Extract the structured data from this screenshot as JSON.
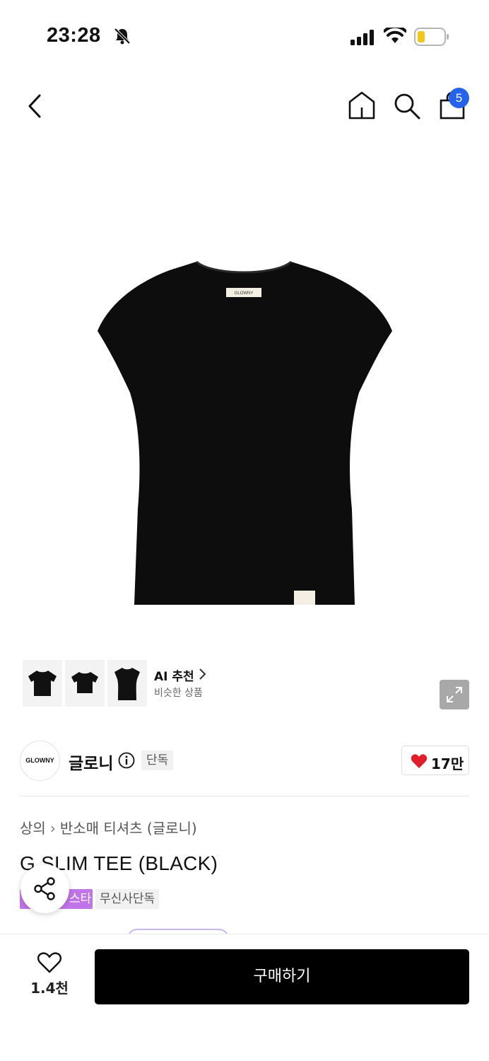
{
  "status_bar": {
    "time": "23:28",
    "icons": [
      "bell-mute-icon",
      "signal-icon",
      "wifi-icon",
      "battery-icon"
    ]
  },
  "nav": {
    "cart_count": "5",
    "icons": [
      "back-icon",
      "home-icon",
      "search-icon",
      "shopping-bag-icon"
    ]
  },
  "product_image": {
    "label_text": "GLOWNY"
  },
  "ai_recommend": {
    "title": "AI 추천",
    "subtitle": "비슷한 상품"
  },
  "brand": {
    "logo_text": "GLOWNY",
    "name": "글로니",
    "exclusive_tag": "단독",
    "likes": "17만"
  },
  "breadcrumb": {
    "category": "상의",
    "subcategory": "반소매 티셔츠 (글로니)"
  },
  "product": {
    "title": "G SLIM TEE (BLACK)",
    "tag_star": "스타",
    "tag_exclusive": "무신사단독"
  },
  "bottom_bar": {
    "wish_count": "1.4천",
    "buy_label": "구매하기"
  },
  "colors": {
    "badge_blue": "#2563eb",
    "heart_red": "#e11d2a",
    "star_tag_purple": "#c174e8",
    "buy_button": "#000000"
  }
}
